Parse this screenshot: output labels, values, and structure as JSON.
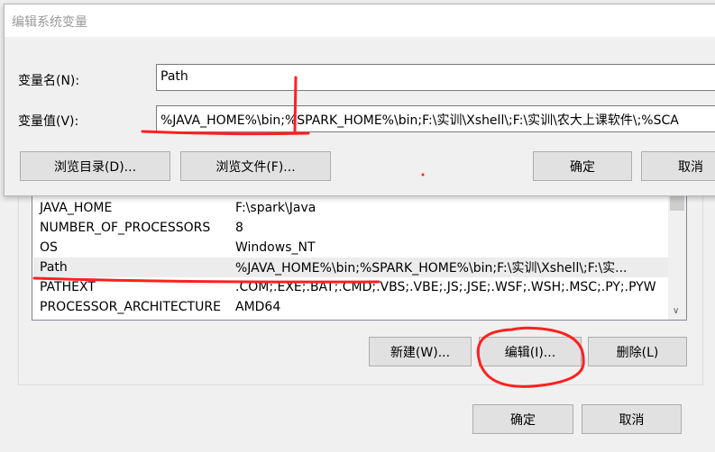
{
  "background_window": {
    "variables": [
      {
        "name": "JAVA_HOME",
        "value": "F:\\spark\\Java"
      },
      {
        "name": "NUMBER_OF_PROCESSORS",
        "value": "8"
      },
      {
        "name": "OS",
        "value": "Windows_NT"
      },
      {
        "name": "Path",
        "value": "%JAVA_HOME%\\bin;%SPARK_HOME%\\bin;F:\\实训\\Xshell\\;F:\\实..."
      },
      {
        "name": "PATHEXT",
        "value": ".COM;.EXE;.BAT;.CMD;.VBS;.VBE;.JS;.JSE;.WSF;.WSH;.MSC;.PY;.PYW"
      },
      {
        "name": "PROCESSOR_ARCHITECTURE",
        "value": "AMD64"
      }
    ],
    "selected": "Path",
    "new_label": "新建(W)...",
    "edit_label": "编辑(I)...",
    "delete_label": "删除(L)",
    "ok_label": "确定",
    "cancel_label": "取消"
  },
  "dialog": {
    "title": "编辑系统变量",
    "name_label": "变量名(N):",
    "name_value": "Path",
    "value_label": "变量值(V):",
    "value_value": "%JAVA_HOME%\\bin;%SPARK_HOME%\\bin;F:\\实训\\Xshell\\;F:\\实训\\农大上课软件\\;%SCA",
    "browse_dir_label": "浏览目录(D)...",
    "browse_file_label": "浏览文件(F)...",
    "ok_label": "确定",
    "cancel_label": "取消"
  },
  "annotation_color": "#ff2020"
}
